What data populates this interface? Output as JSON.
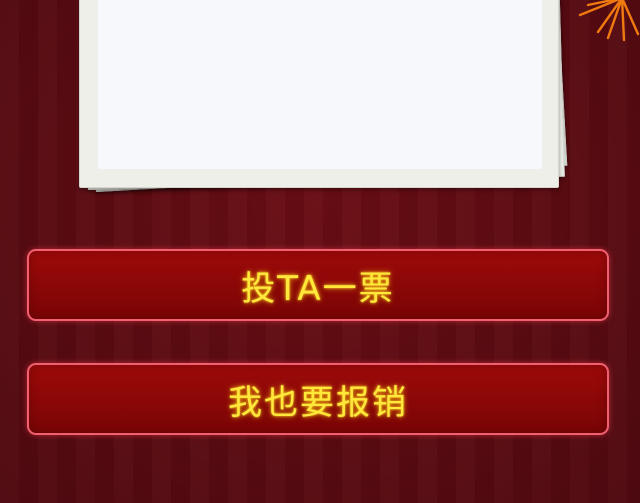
{
  "buttons": {
    "vote_label": "投TA一票",
    "claim_label": "我也要报销"
  },
  "colors": {
    "background": "#640d14",
    "button_fill": "#8a0707",
    "button_border": "#f06070",
    "button_text": "#ffe83a",
    "paper": "#f7f8fb",
    "firework": "#f07a10"
  },
  "icons": {
    "decoration": "firework-icon"
  }
}
